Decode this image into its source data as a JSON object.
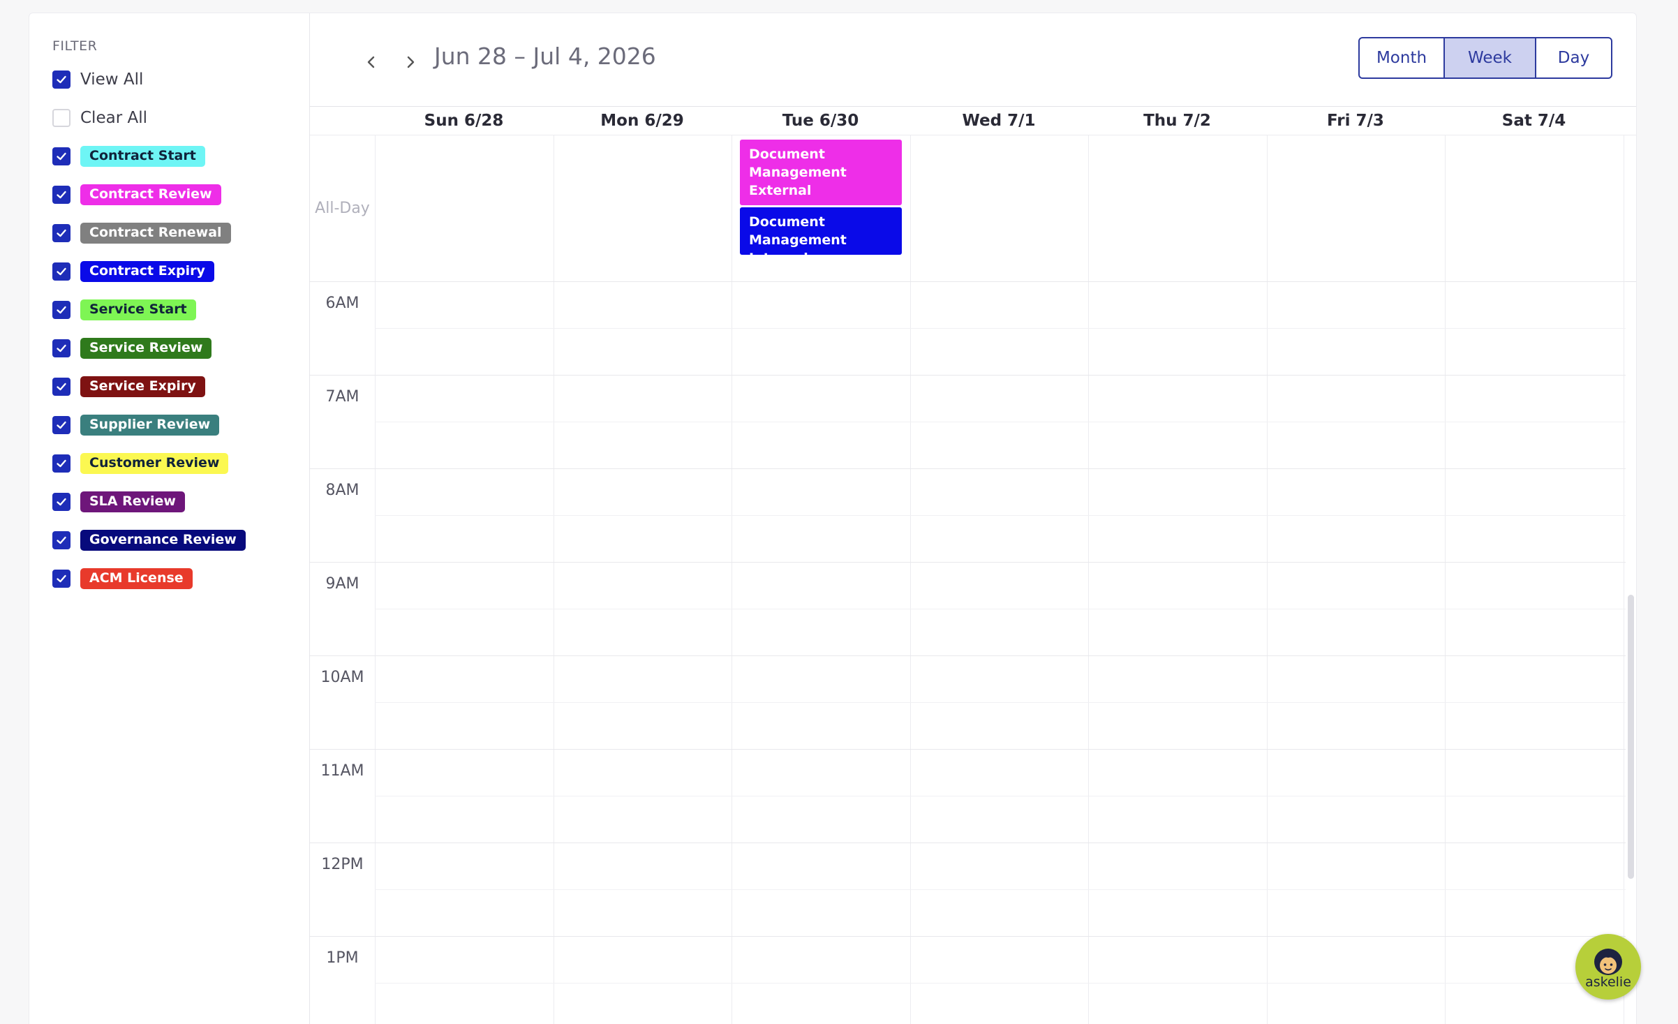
{
  "sidebar": {
    "filter_title": "FILTER",
    "view_all": "View All",
    "clear_all": "Clear All",
    "items": [
      {
        "label": "Contract Start",
        "bg": "#6ef5f5",
        "fg": "#10233a",
        "checked": true
      },
      {
        "label": "Contract Review",
        "bg": "#ee2ee8",
        "fg": "#ffffff",
        "checked": true
      },
      {
        "label": "Contract Renewal",
        "bg": "#808080",
        "fg": "#ffffff",
        "checked": true
      },
      {
        "label": "Contract Expiry",
        "bg": "#0a0ae8",
        "fg": "#ffffff",
        "checked": true
      },
      {
        "label": "Service Start",
        "bg": "#7ef554",
        "fg": "#10233a",
        "checked": true
      },
      {
        "label": "Service Review",
        "bg": "#2f7a1c",
        "fg": "#ffffff",
        "checked": true
      },
      {
        "label": "Service Expiry",
        "bg": "#7e1212",
        "fg": "#ffffff",
        "checked": true
      },
      {
        "label": "Supplier Review",
        "bg": "#3a7f7e",
        "fg": "#ffffff",
        "checked": true
      },
      {
        "label": "Customer Review",
        "bg": "#fbf851",
        "fg": "#10233a",
        "checked": true
      },
      {
        "label": "SLA Review",
        "bg": "#6e167a",
        "fg": "#ffffff",
        "checked": true
      },
      {
        "label": "Governance Review",
        "bg": "#070a7c",
        "fg": "#ffffff",
        "checked": true
      },
      {
        "label": "ACM License",
        "bg": "#e83a2b",
        "fg": "#ffffff",
        "checked": true
      }
    ]
  },
  "header": {
    "prev_icon": "chevron-left-icon",
    "next_icon": "chevron-right-icon",
    "date_range": "Jun 28 – Jul 4, 2026",
    "views": [
      {
        "label": "Month",
        "active": false
      },
      {
        "label": "Week",
        "active": true
      },
      {
        "label": "Day",
        "active": false
      }
    ]
  },
  "calendar": {
    "days": [
      "Sun 6/28",
      "Mon 6/29",
      "Tue 6/30",
      "Wed 7/1",
      "Thu 7/2",
      "Fri 7/3",
      "Sat 7/4"
    ],
    "all_day_label": "All-Day",
    "times": [
      "6AM",
      "7AM",
      "8AM",
      "9AM",
      "10AM",
      "11AM",
      "12PM",
      "1PM"
    ],
    "all_day_events": [
      {
        "title": "Document Management External",
        "day": "Tue 6/30",
        "color": "#ee2ee8"
      },
      {
        "title": "Document Management Internal",
        "day": "Tue 6/30",
        "color": "#0a0ae8"
      }
    ]
  },
  "assistant": {
    "label": "askelie",
    "icon": "avatar-icon"
  }
}
